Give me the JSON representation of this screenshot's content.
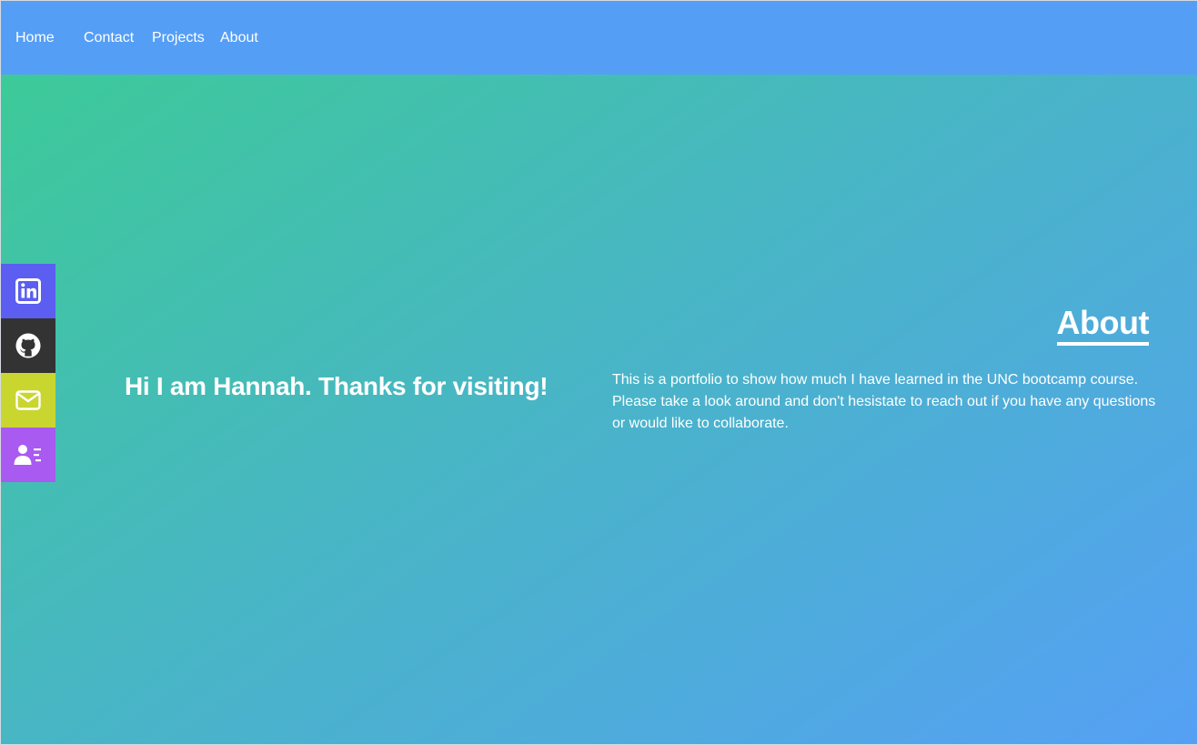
{
  "nav": {
    "home": "Home",
    "contact": "Contact",
    "projects": "Projects",
    "about": "About"
  },
  "social": [
    {
      "icon": "linkedin-icon",
      "color": "#5b5ef0"
    },
    {
      "icon": "github-icon",
      "color": "#333333"
    },
    {
      "icon": "email-icon",
      "color": "#c9d630"
    },
    {
      "icon": "contact-card-icon",
      "color": "#a95af0"
    }
  ],
  "hero": {
    "greeting": "Hi I am Hannah. Thanks for visiting!",
    "about_title": "About",
    "about_text": "This is a portfolio to show how much I have learned in the UNC bootcamp course. Please take a look around and don't hesistate to reach out if you have any questions or would like to collaborate."
  },
  "colors": {
    "navbar": "#559ef5",
    "gradient_start": "#3dca98",
    "gradient_end": "#55a0f5",
    "text": "#ffffff"
  }
}
